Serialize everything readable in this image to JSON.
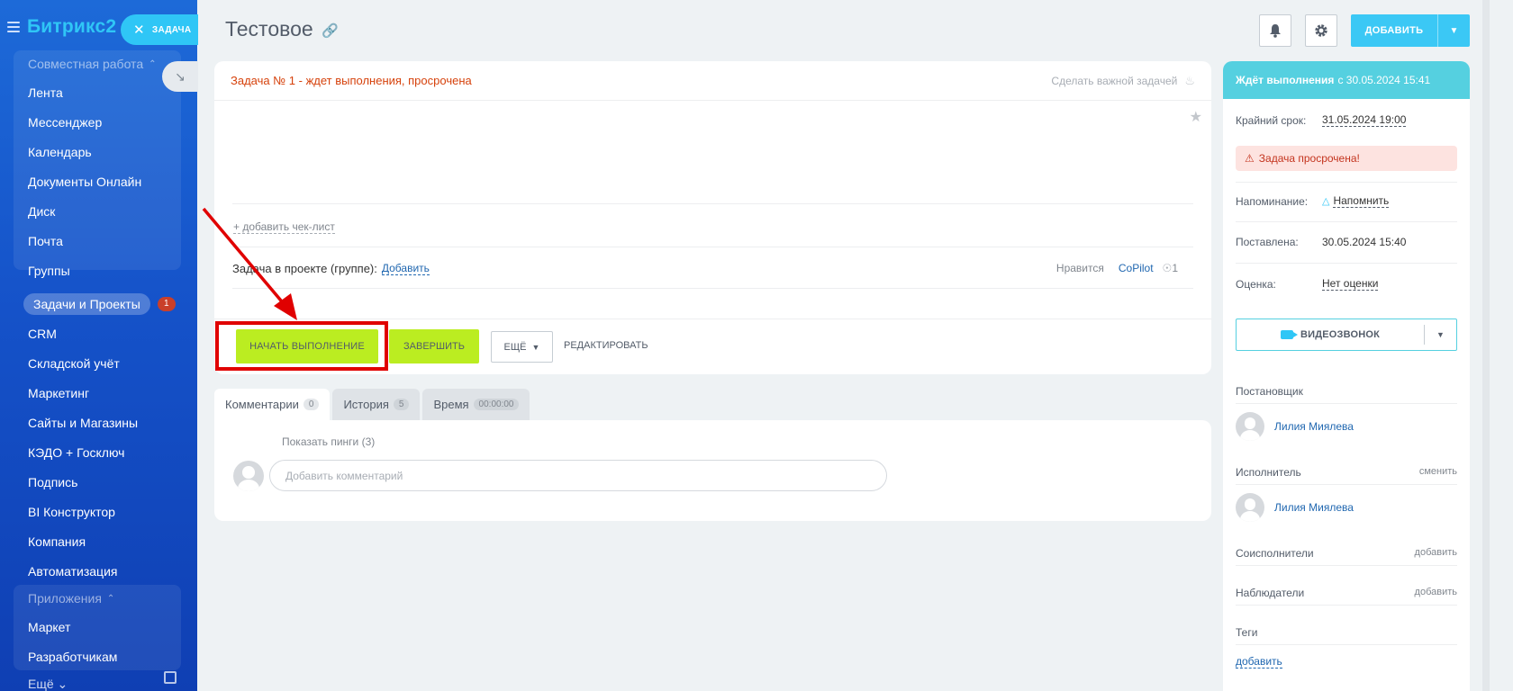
{
  "sidebar": {
    "brand_main": "Битрикс",
    "brand_accent": "2",
    "task_chip_label": "ЗАДАЧА",
    "group1_title": "Совместная работа",
    "group1_items": [
      "Лента",
      "Мессенджер",
      "Календарь",
      "Документы Онлайн",
      "Диск",
      "Почта",
      "Группы"
    ],
    "active_item": "Задачи и Проекты",
    "active_badge": "1",
    "items": [
      "CRM",
      "Складской учёт",
      "Маркетинг",
      "Сайты и Магазины",
      "КЭДО + Госключ",
      "Подпись",
      "BI Конструктор",
      "Компания",
      "Автоматизация"
    ],
    "group2_title": "Приложения",
    "group2_items": [
      "Маркет",
      "Разработчикам"
    ],
    "more_label": "Ещё"
  },
  "header": {
    "title": "Тестовое",
    "add_label": "ДОБАВИТЬ"
  },
  "task": {
    "status": "Задача № 1 - ждет выполнения, просрочена",
    "make_important": "Сделать важной задачей",
    "add_checklist": "+ добавить чек-лист",
    "project_label": "Задача в проекте (группе):",
    "project_add": "Добавить",
    "like_label": "Нравится",
    "copilot": "CoPilot",
    "views": "1",
    "btn_start": "НАЧАТЬ ВЫПОЛНЕНИЕ",
    "btn_finish": "ЗАВЕРШИТЬ",
    "btn_more": "ЕЩЁ",
    "btn_edit": "РЕДАКТИРОВАТЬ"
  },
  "tabs": [
    {
      "label": "Комментарии",
      "count": "0"
    },
    {
      "label": "История",
      "count": "5"
    },
    {
      "label": "Время",
      "count": "00:00:00"
    }
  ],
  "comments": {
    "show_pings": "Показать пинги (3)",
    "placeholder": "Добавить комментарий"
  },
  "panel": {
    "head_bold": "Ждёт выполнения",
    "head_rest": "с 30.05.2024 15:41",
    "deadline_label": "Крайний срок:",
    "deadline_value": "31.05.2024 19:00",
    "overdue_text": "Задача просрочена!",
    "reminder_label": "Напоминание:",
    "reminder_value": "Напомнить",
    "created_label": "Поставлена:",
    "created_value": "30.05.2024 15:40",
    "rating_label": "Оценка:",
    "rating_value": "Нет оценки",
    "video_label": "ВИДЕОЗВОНОК",
    "creator_title": "Постановщик",
    "creator_name": "Лилия Миялева",
    "assignee_title": "Исполнитель",
    "assignee_change": "сменить",
    "assignee_name": "Лилия Миялева",
    "coexec_title": "Соисполнители",
    "coexec_add": "добавить",
    "observers_title": "Наблюдатели",
    "observers_add": "добавить",
    "tags_title": "Теги",
    "tags_add": "добавить"
  },
  "colors": {
    "sidebar_top": "#1d6ad8",
    "accent": "#2fc6f6",
    "action_green": "#bbed21",
    "overdue_red": "#d6420c",
    "annotation_red": "#e00000"
  }
}
